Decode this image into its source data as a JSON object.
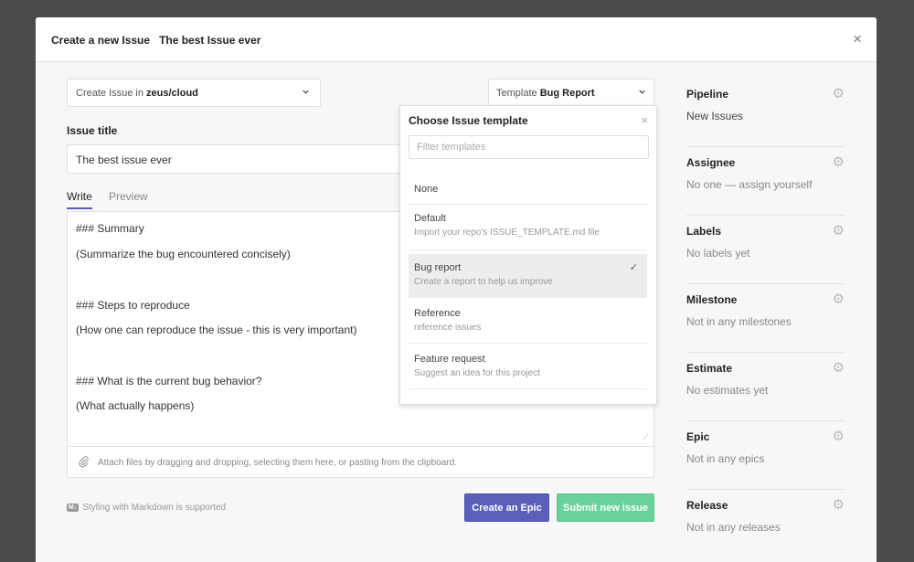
{
  "header": {
    "title_prefix": "Create a new Issue",
    "title_name": "The best Issue ever",
    "close_icon": "×"
  },
  "repo_select": {
    "label": "Create Issue in",
    "repo": "zeus/cloud"
  },
  "template_select": {
    "label": "Template",
    "value": "Bug Report"
  },
  "title_field": {
    "label": "Issue title",
    "value": "The best issue ever"
  },
  "tabs": {
    "write": "Write",
    "preview": "Preview"
  },
  "editor": {
    "lines": [
      "### Summary",
      "(Summarize the bug encountered concisely)",
      "### Steps to reproduce",
      "(How one can reproduce the issue - this is very important)",
      "### What is the current bug behavior?",
      "(What actually happens)"
    ]
  },
  "attach": {
    "text": "Attach files by dragging and dropping, selecting them here, or pasting from the clipboard."
  },
  "markdown_note": {
    "badge": "M↓",
    "text": "Styling with Markdown is supported"
  },
  "buttons": {
    "create_epic": "Create an Epic",
    "submit": "Submit new issue"
  },
  "colors": {
    "accent": "#5a5fba",
    "submit": "#68d29a"
  },
  "dropdown": {
    "title": "Choose Issue template",
    "filter_placeholder": "Filter templates",
    "close_icon": "×",
    "check_icon": "✓",
    "items": [
      {
        "name": "None",
        "desc": ""
      },
      {
        "name": "Default",
        "desc": "Import your repo's ISSUE_TEMPLATE.md file"
      },
      {
        "name": "Bug report",
        "desc": "Create a report to help us improve"
      },
      {
        "name": "Reference",
        "desc": "reference issues"
      },
      {
        "name": "Feature request",
        "desc": "Suggest an idea for this project"
      }
    ]
  },
  "sidebar": {
    "sections": [
      {
        "title": "Pipeline",
        "value": "New Issues"
      },
      {
        "title": "Assignee",
        "value": "No one — assign yourself"
      },
      {
        "title": "Labels",
        "value": "No labels yet"
      },
      {
        "title": "Milestone",
        "value": "Not in any milestones"
      },
      {
        "title": "Estimate",
        "value": "No estimates yet"
      },
      {
        "title": "Epic",
        "value": "Not in any epics"
      },
      {
        "title": "Release",
        "value": "Not in any releases"
      }
    ]
  }
}
